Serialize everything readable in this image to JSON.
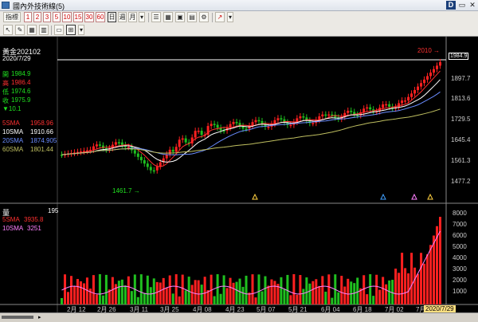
{
  "window": {
    "title": "國內外技術線(5)",
    "controls": [
      "D",
      "▭",
      "✕"
    ]
  },
  "toolbar1": {
    "label": "指標",
    "periods": [
      "1",
      "2",
      "3",
      "5",
      "10",
      "15",
      "30",
      "60"
    ],
    "day": "日",
    "week": "週",
    "month": "月"
  },
  "toolbar2": {
    "icons": [
      "cursor-icon",
      "pen-icon",
      "grid-icon",
      "layout-icon",
      "grid-table-icon"
    ]
  },
  "info": {
    "name": "黃金202102",
    "date": "2020/7/29",
    "open_label": "開",
    "open": "1984.9",
    "high_label": "高",
    "high": "1986.4",
    "low_label": "低",
    "low": "1974.6",
    "close_label": "收",
    "close": "1975.9",
    "change": "▼10.1",
    "sma": [
      {
        "label": "5SMA",
        "value": "1958.96",
        "color": "#ff3030"
      },
      {
        "label": "10SMA",
        "value": "1910.66",
        "color": "#ffffff"
      },
      {
        "label": "20SMA",
        "value": "1874.905",
        "color": "#6a8cff"
      },
      {
        "label": "60SMA",
        "value": "1801.44",
        "color": "#bfbf60"
      }
    ]
  },
  "price_axis": [
    "1984.9",
    "1897.7",
    "1813.6",
    "1729.5",
    "1645.4",
    "1561.3",
    "1477.2"
  ],
  "price_badge": "1984.9",
  "annotations": {
    "high_note": "2010 →",
    "low_note": "1461.7 →"
  },
  "volume_panel": {
    "label": "量",
    "value": "195",
    "sma": [
      {
        "label": "5SMA",
        "value": "3935.8",
        "color": "#ff3030"
      },
      {
        "label": "10SMA",
        "value": "3251",
        "color": "#ff80ff"
      }
    ],
    "axis": [
      "8000",
      "7000",
      "6000",
      "5000",
      "4000",
      "3000",
      "2000",
      "1000"
    ]
  },
  "date_axis": [
    "2月 12",
    "2月 26",
    "3月 11",
    "3月 25",
    "4月 08",
    "4月 23",
    "5月 07",
    "5月 21",
    "6月 04",
    "6月 18",
    "7月 02",
    "7月 1"
  ],
  "cursor_date": "2020/7/29",
  "colors": {
    "up": "#ff2020",
    "down": "#20c020",
    "bg": "#000000"
  }
}
